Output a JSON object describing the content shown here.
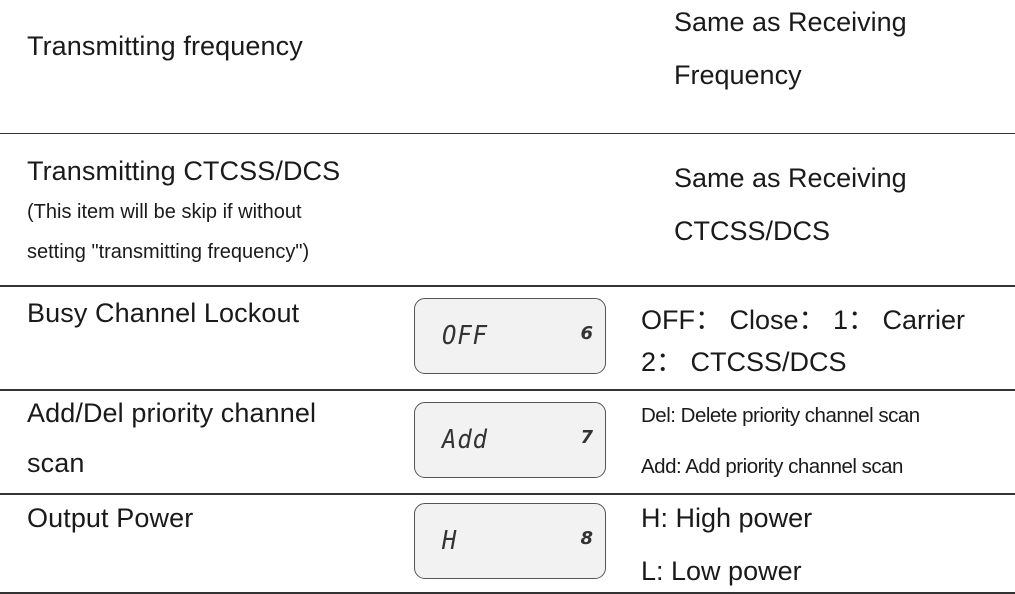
{
  "rows": [
    {
      "label": "Transmitting frequency",
      "value_lines": [
        "Same as Receiving",
        "Frequency"
      ]
    },
    {
      "label": "Transmitting CTCSS/DCS",
      "note_lines": [
        "(This item will be skip if without",
        "setting \"transmitting frequency\")"
      ],
      "value_lines": [
        "Same as Receiving",
        "CTCSS/DCS"
      ]
    },
    {
      "label": "Busy Channel Lockout",
      "lcd": {
        "text": "OFF",
        "number": "6"
      },
      "value_lines": [
        "OFF： Close： 1： Carrier",
        "2： CTCSS/DCS"
      ]
    },
    {
      "label_lines": [
        "Add/Del priority channel",
        "scan"
      ],
      "lcd": {
        "text": "Add",
        "number": "7"
      },
      "value_lines": [
        "Del: Delete priority channel scan",
        "Add: Add priority channel scan"
      ]
    },
    {
      "label": "Output Power",
      "lcd": {
        "text": "H",
        "number": "8"
      },
      "value_lines": [
        "H: High power",
        "L: Low power"
      ]
    }
  ]
}
